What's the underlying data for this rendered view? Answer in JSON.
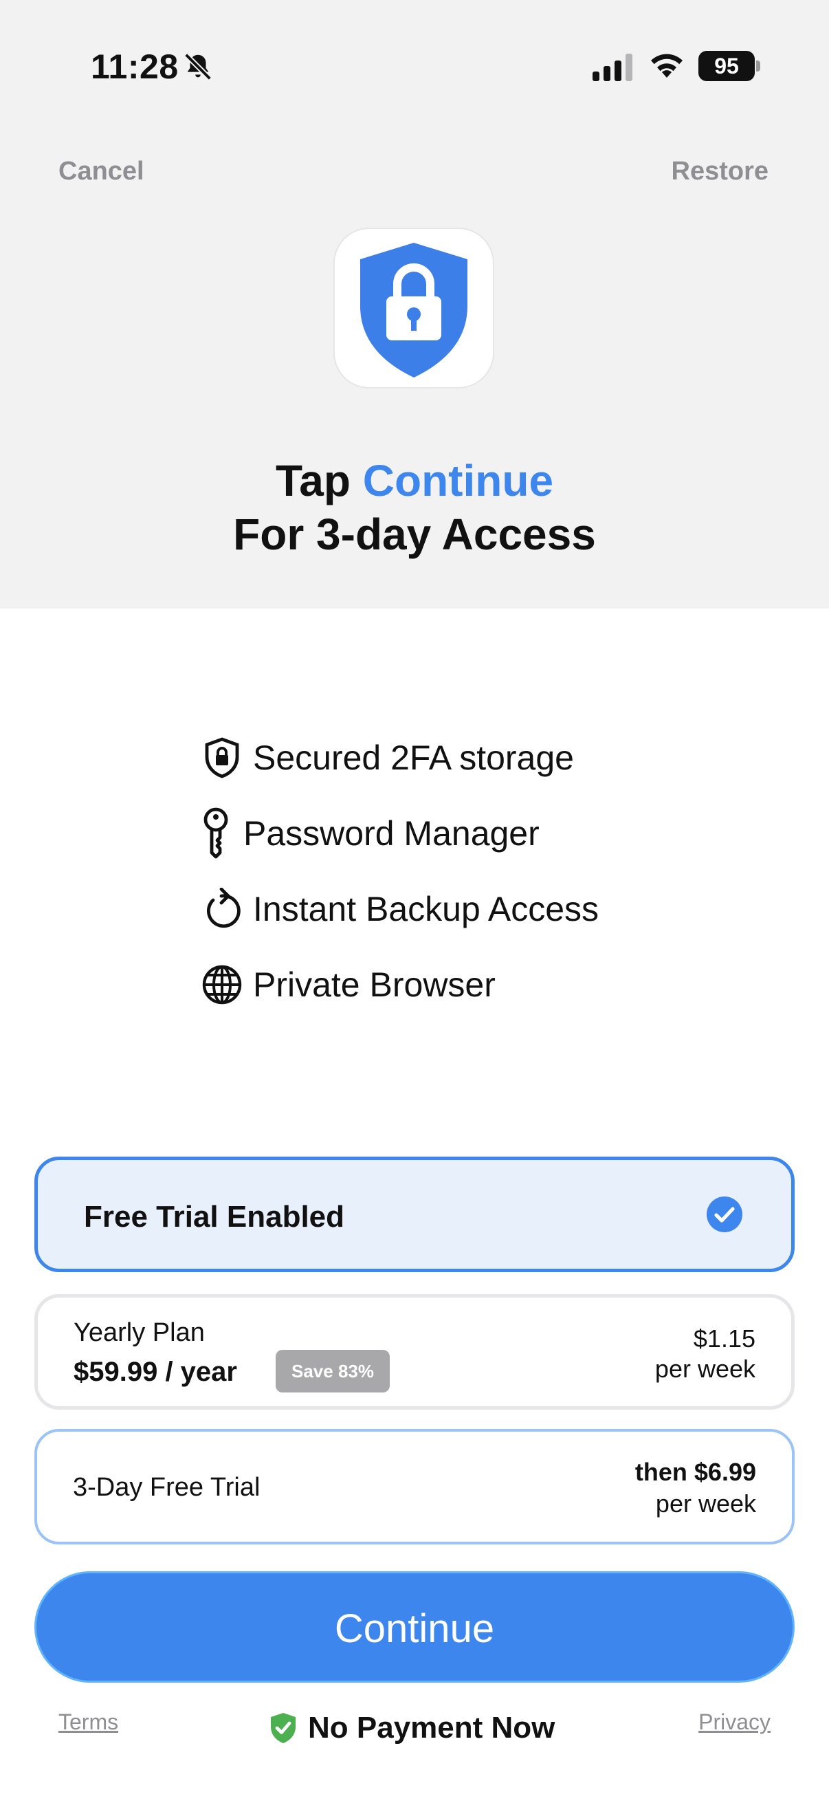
{
  "status_bar": {
    "time": "11:28",
    "battery": "95"
  },
  "header": {
    "cancel_label": "Cancel",
    "restore_label": "Restore",
    "headline_prefix": "Tap ",
    "headline_accent": "Continue",
    "headline_line2": "For 3-day Access",
    "accent_color": "#3d86ee"
  },
  "features": [
    {
      "icon": "shield-lock-icon",
      "label": "Secured 2FA storage"
    },
    {
      "icon": "key-icon",
      "label": "Password Manager"
    },
    {
      "icon": "backup-icon",
      "label": "Instant Backup Access"
    },
    {
      "icon": "globe-icon",
      "label": "Private Browser"
    }
  ],
  "plans": {
    "trial_toggle": {
      "label": "Free Trial Enabled",
      "checked": true
    },
    "yearly": {
      "name": "Yearly Plan",
      "price": "$59.99 / year",
      "badge": "Save 83%",
      "weekly_price": "$1.15",
      "weekly_unit": "per week"
    },
    "trial": {
      "name": "3-Day Free Trial",
      "after_price": "then $6.99",
      "after_unit": "per week"
    }
  },
  "cta": {
    "label": "Continue"
  },
  "footer": {
    "terms_label": "Terms",
    "no_payment_label": "No Payment Now",
    "privacy_label": "Privacy"
  }
}
